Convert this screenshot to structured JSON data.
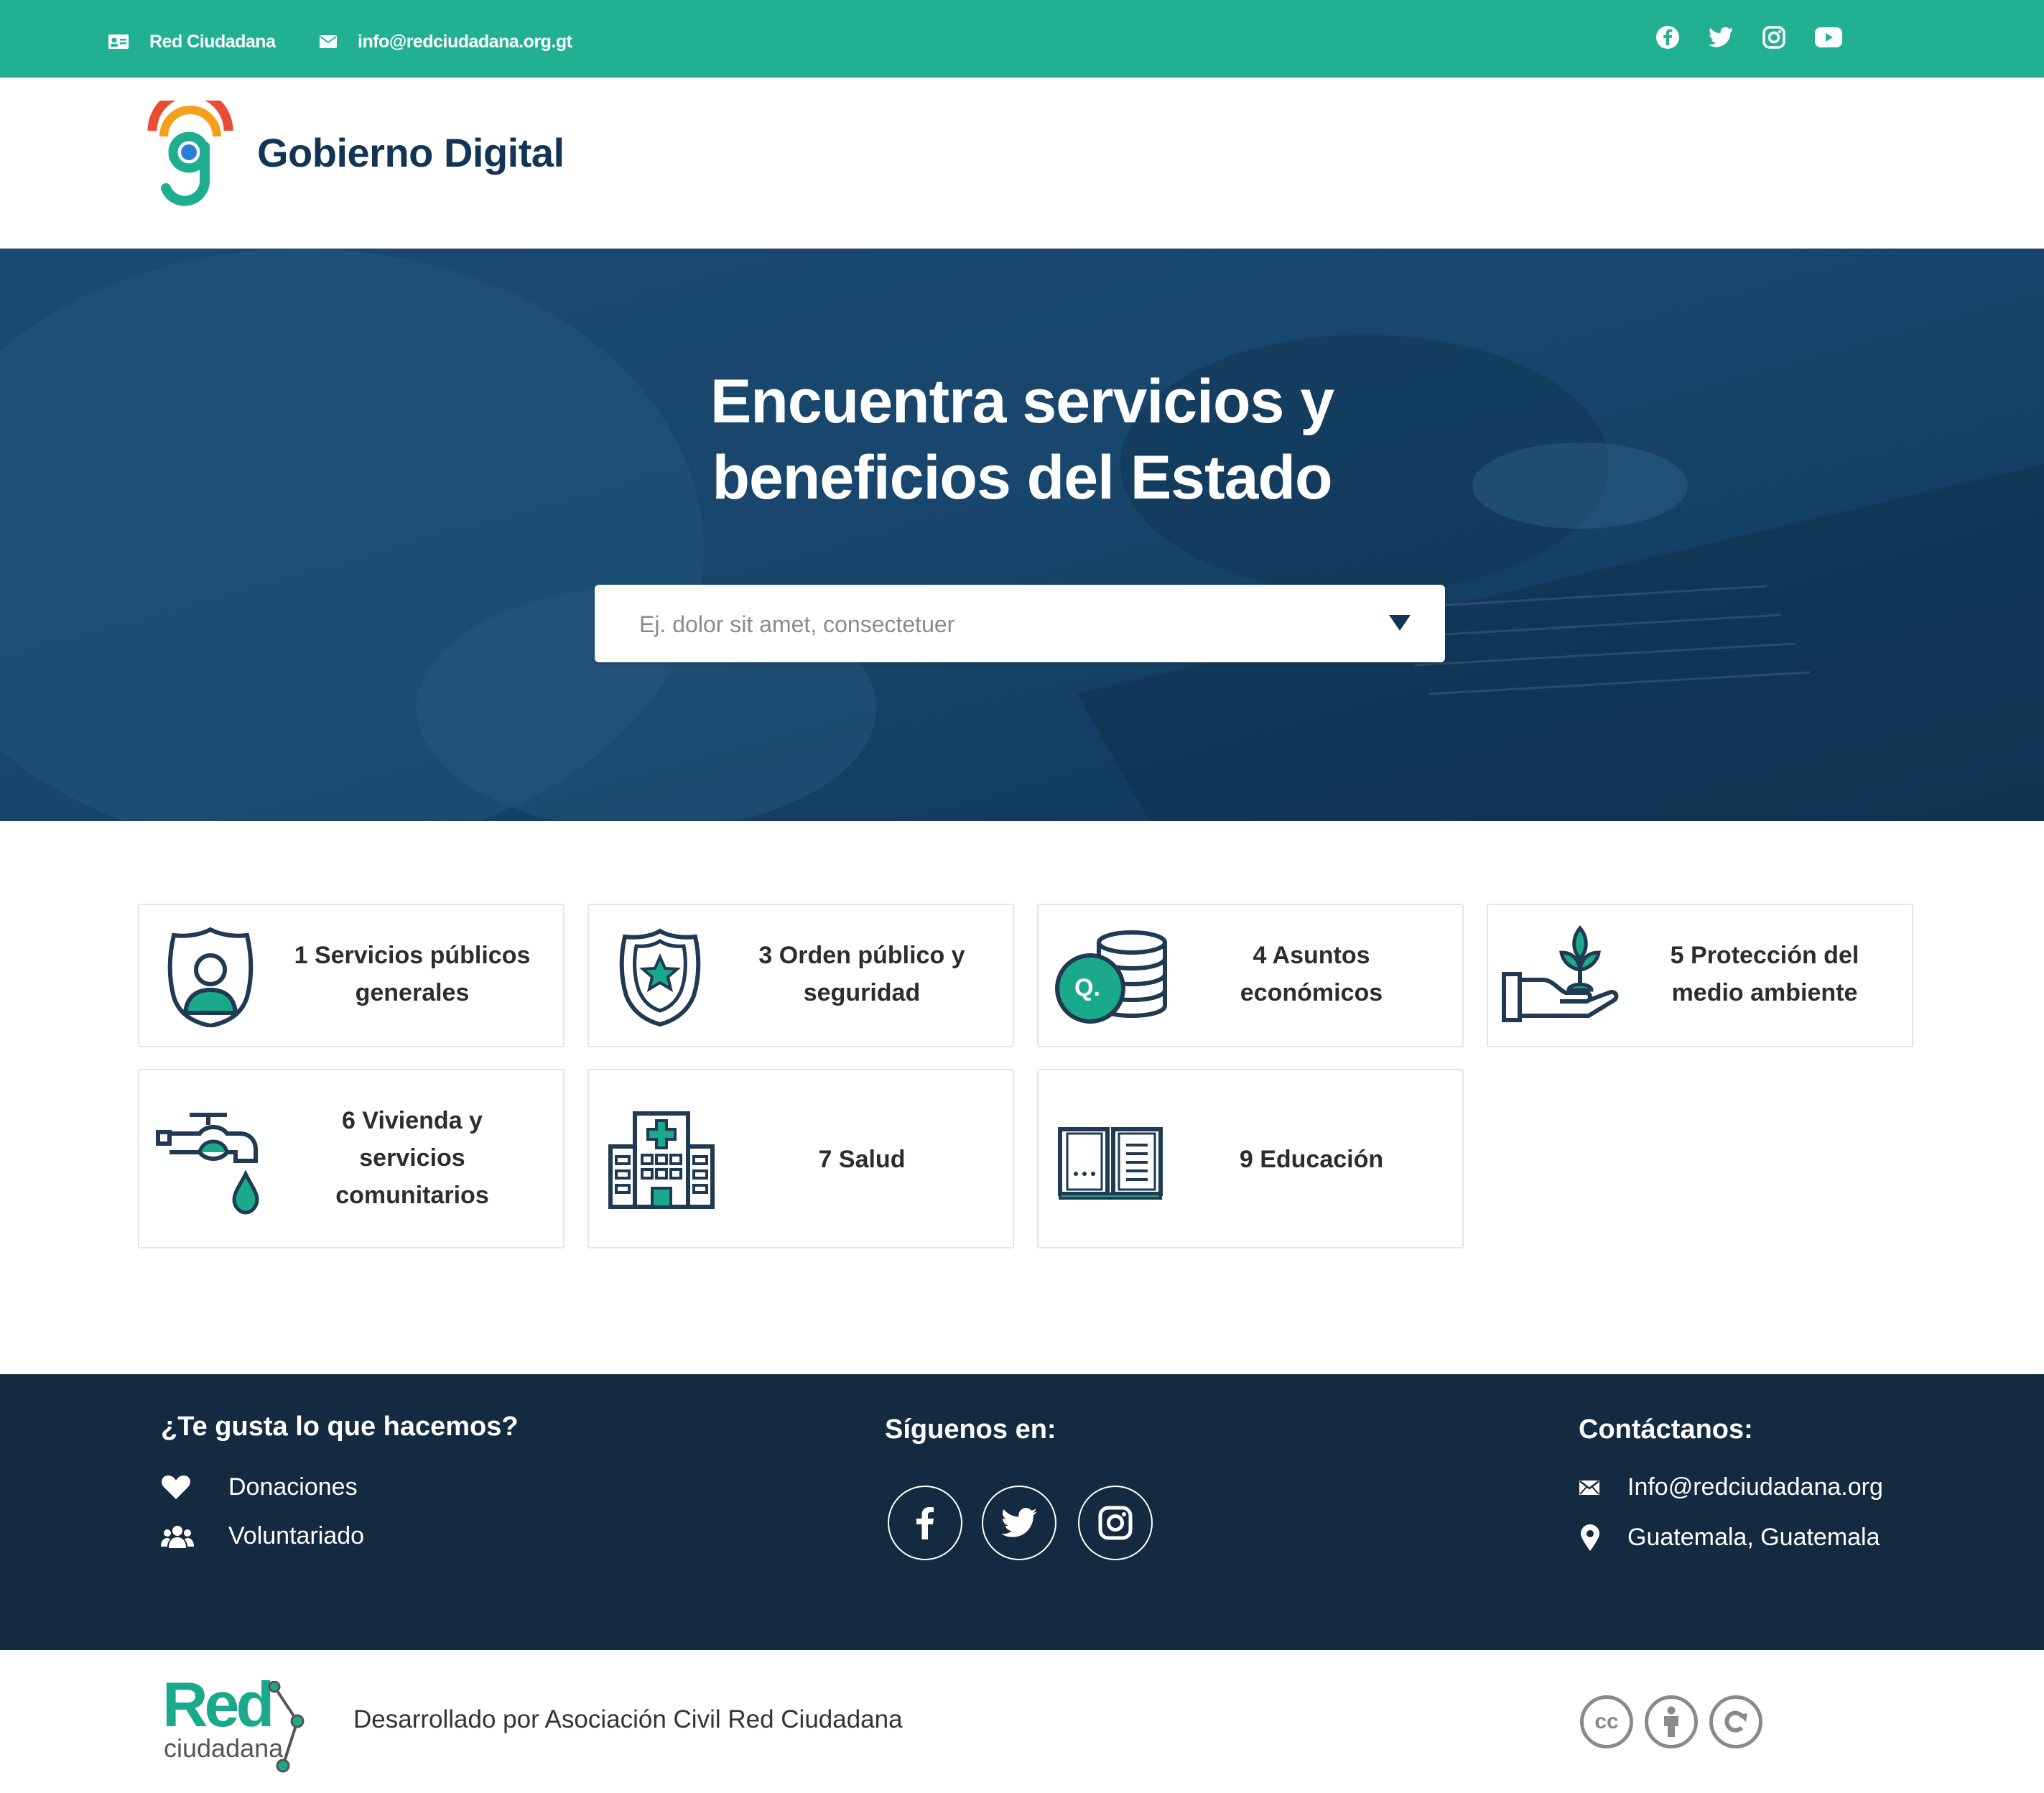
{
  "topbar": {
    "org_name": "Red Ciudadana",
    "email": "info@redciudadana.org.gt",
    "social_icons": [
      "facebook-icon",
      "twitter-icon",
      "instagram-icon",
      "youtube-icon"
    ],
    "background": "#21b192"
  },
  "header": {
    "brand_name": "Gobierno Digital"
  },
  "hero": {
    "title_line1": "Encuentra servicios y",
    "title_line2": "beneficios del Estado",
    "search_placeholder": "Ej. dolor sit amet, consectetuer",
    "background": "#153f62"
  },
  "categories": [
    {
      "label_line1": "1 Servicios públicos",
      "label_line2": "generales",
      "icon": "police-badge-person-icon"
    },
    {
      "label_line1": "3 Orden público y",
      "label_line2": "seguridad",
      "icon": "sheriff-badge-icon"
    },
    {
      "label_line1": "4 Asuntos",
      "label_line2": "económicos",
      "icon": "coins-stack-icon",
      "icon_text": "Q."
    },
    {
      "label_line1": "5 Protección del",
      "label_line2": "medio ambiente",
      "icon": "plant-hand-icon"
    },
    {
      "label_line1": "6 Vivienda y",
      "label_line2": "servicios",
      "label_line3": "comunitarios",
      "icon": "faucet-icon"
    },
    {
      "label_line1": "7 Salud",
      "icon": "hospital-icon"
    },
    {
      "label_line1": "9 Educación",
      "icon": "open-book-icon"
    }
  ],
  "footer": {
    "like_title": "¿Te gusta lo que hacemos?",
    "donations": "Donaciones",
    "volunteer": "Voluntariado",
    "follow_title": "Síguenos en:",
    "contact_title": "Contáctanos:",
    "contact_email": "Info@redciudadana.org",
    "contact_location": "Guatemala, Guatemala",
    "background": "#142a40"
  },
  "bottom": {
    "logo_red": "Red",
    "logo_ciudadana": "ciudadana",
    "developed_by": "Desarrollado por Asociación Civil Red Ciudadana",
    "cc_text": "cc"
  },
  "colors": {
    "accent_teal": "#21b192",
    "navy": "#123556",
    "icon_teal": "#1aa98a"
  }
}
